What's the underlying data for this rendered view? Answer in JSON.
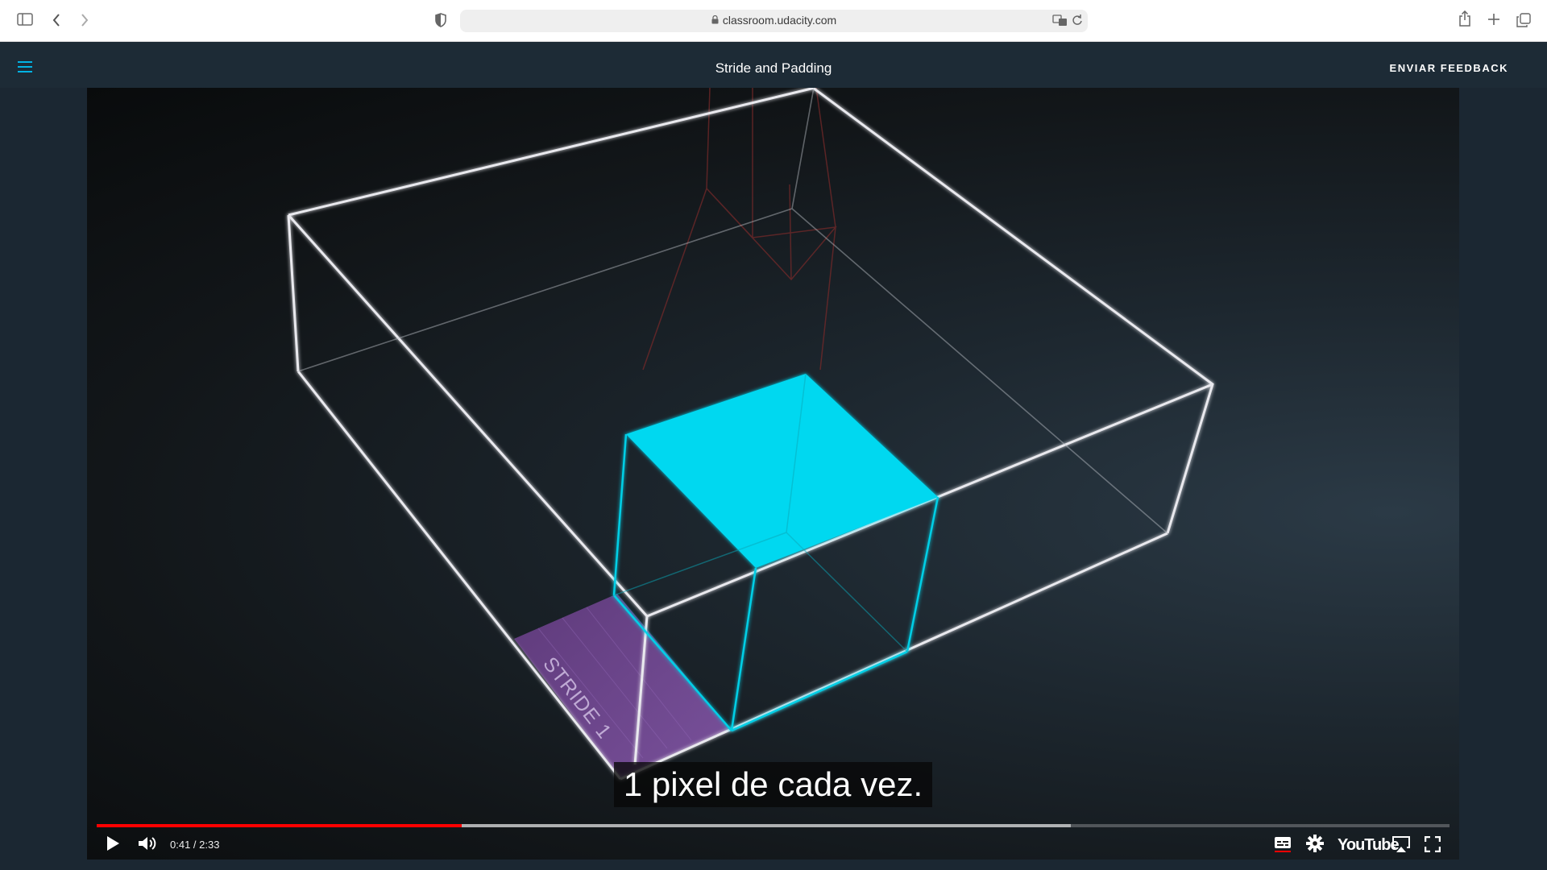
{
  "browser": {
    "url": "classroom.udacity.com"
  },
  "header": {
    "title": "Stride and Padding",
    "feedback_label": "ENVIAR FEEDBACK"
  },
  "video": {
    "scene_label": "STRIDE 1",
    "caption": "1 pixel de cada vez.",
    "current_time": "0:41",
    "duration": "2:33",
    "time_display": "0:41 / 2:33",
    "progress": 0.27,
    "buffered": 0.72,
    "brand": "YouTube"
  },
  "colors": {
    "accent": "#02b3e4",
    "cyan_face": "#00d8f0",
    "stride_band": "#7b4d9a",
    "progress": "#ff0000"
  },
  "icons": [
    "sidebar-toggle-icon",
    "back-icon",
    "forward-icon",
    "shield-icon",
    "lock-icon",
    "translate-icon",
    "reload-icon",
    "share-icon",
    "new-tab-icon",
    "tab-overview-icon",
    "menu-icon",
    "play-icon",
    "volume-icon",
    "subtitles-icon",
    "settings-icon",
    "airplay-icon",
    "fullscreen-icon"
  ]
}
